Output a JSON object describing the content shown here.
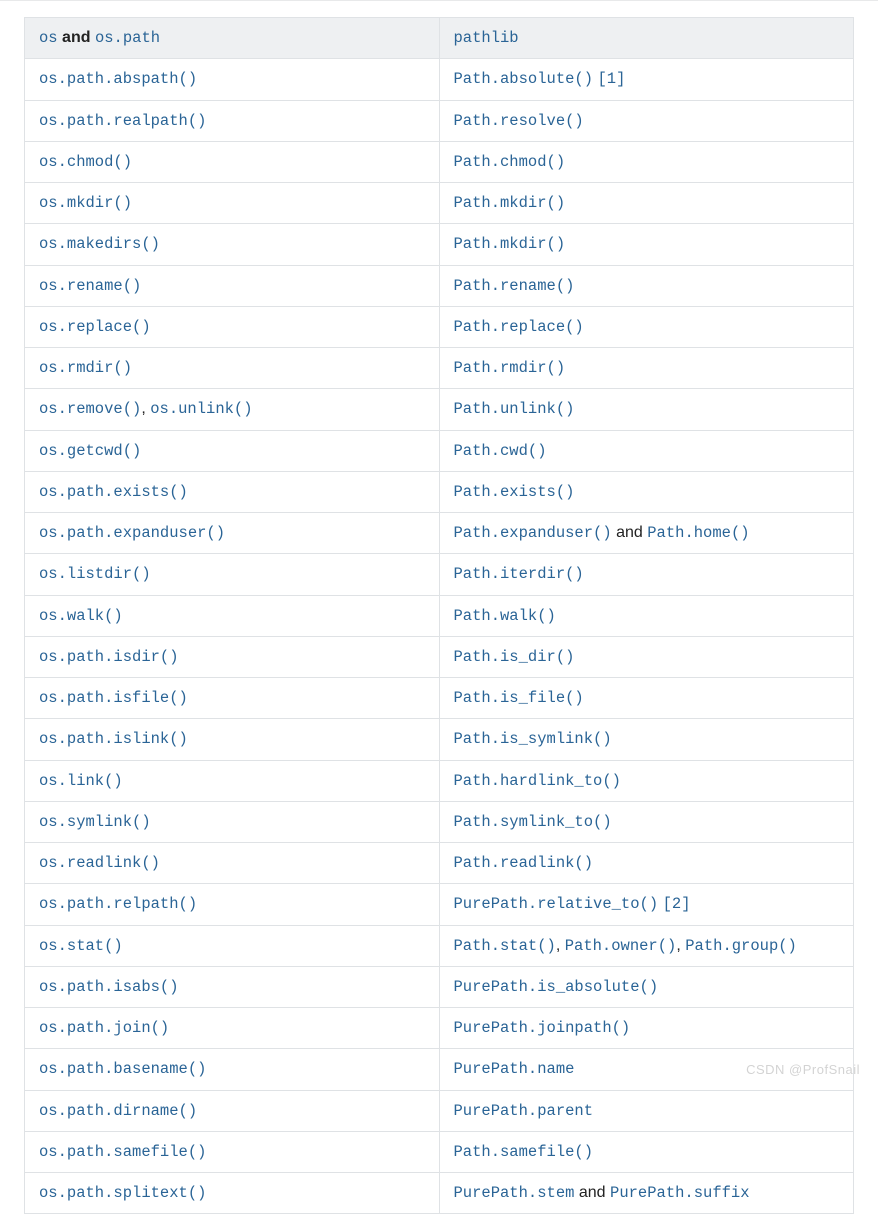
{
  "header": {
    "left": {
      "parts": [
        {
          "type": "link",
          "text": "os"
        },
        {
          "type": "bold",
          "text": " and "
        },
        {
          "type": "link",
          "text": "os.path"
        }
      ]
    },
    "right": {
      "parts": [
        {
          "type": "link",
          "text": "pathlib"
        }
      ]
    }
  },
  "rows": [
    {
      "left": [
        {
          "type": "link",
          "text": "os.path.abspath()"
        }
      ],
      "right": [
        {
          "type": "link",
          "text": "Path.absolute()"
        },
        {
          "type": "plain",
          "text": " "
        },
        {
          "type": "link",
          "text": "[1]"
        }
      ]
    },
    {
      "left": [
        {
          "type": "link",
          "text": "os.path.realpath()"
        }
      ],
      "right": [
        {
          "type": "link",
          "text": "Path.resolve()"
        }
      ]
    },
    {
      "left": [
        {
          "type": "link",
          "text": "os.chmod()"
        }
      ],
      "right": [
        {
          "type": "link",
          "text": "Path.chmod()"
        }
      ]
    },
    {
      "left": [
        {
          "type": "link",
          "text": "os.mkdir()"
        }
      ],
      "right": [
        {
          "type": "link",
          "text": "Path.mkdir()"
        }
      ]
    },
    {
      "left": [
        {
          "type": "link",
          "text": "os.makedirs()"
        }
      ],
      "right": [
        {
          "type": "link",
          "text": "Path.mkdir()"
        }
      ]
    },
    {
      "left": [
        {
          "type": "link",
          "text": "os.rename()"
        }
      ],
      "right": [
        {
          "type": "link",
          "text": "Path.rename()"
        }
      ]
    },
    {
      "left": [
        {
          "type": "link",
          "text": "os.replace()"
        }
      ],
      "right": [
        {
          "type": "link",
          "text": "Path.replace()"
        }
      ]
    },
    {
      "left": [
        {
          "type": "link",
          "text": "os.rmdir()"
        }
      ],
      "right": [
        {
          "type": "link",
          "text": "Path.rmdir()"
        }
      ]
    },
    {
      "left": [
        {
          "type": "link",
          "text": "os.remove()"
        },
        {
          "type": "sep",
          "text": ", "
        },
        {
          "type": "link",
          "text": "os.unlink()"
        }
      ],
      "right": [
        {
          "type": "link",
          "text": "Path.unlink()"
        }
      ]
    },
    {
      "left": [
        {
          "type": "link",
          "text": "os.getcwd()"
        }
      ],
      "right": [
        {
          "type": "link",
          "text": "Path.cwd()"
        }
      ]
    },
    {
      "left": [
        {
          "type": "link",
          "text": "os.path.exists()"
        }
      ],
      "right": [
        {
          "type": "link",
          "text": "Path.exists()"
        }
      ]
    },
    {
      "left": [
        {
          "type": "link",
          "text": "os.path.expanduser()"
        }
      ],
      "right": [
        {
          "type": "link",
          "text": "Path.expanduser()"
        },
        {
          "type": "plain",
          "text": " and "
        },
        {
          "type": "link",
          "text": "Path.home()"
        }
      ]
    },
    {
      "left": [
        {
          "type": "link",
          "text": "os.listdir()"
        }
      ],
      "right": [
        {
          "type": "link",
          "text": "Path.iterdir()"
        }
      ]
    },
    {
      "left": [
        {
          "type": "link",
          "text": "os.walk()"
        }
      ],
      "right": [
        {
          "type": "link",
          "text": "Path.walk()"
        }
      ]
    },
    {
      "left": [
        {
          "type": "link",
          "text": "os.path.isdir()"
        }
      ],
      "right": [
        {
          "type": "link",
          "text": "Path.is_dir()"
        }
      ]
    },
    {
      "left": [
        {
          "type": "link",
          "text": "os.path.isfile()"
        }
      ],
      "right": [
        {
          "type": "link",
          "text": "Path.is_file()"
        }
      ]
    },
    {
      "left": [
        {
          "type": "link",
          "text": "os.path.islink()"
        }
      ],
      "right": [
        {
          "type": "link",
          "text": "Path.is_symlink()"
        }
      ]
    },
    {
      "left": [
        {
          "type": "link",
          "text": "os.link()"
        }
      ],
      "right": [
        {
          "type": "link",
          "text": "Path.hardlink_to()"
        }
      ]
    },
    {
      "left": [
        {
          "type": "link",
          "text": "os.symlink()"
        }
      ],
      "right": [
        {
          "type": "link",
          "text": "Path.symlink_to()"
        }
      ]
    },
    {
      "left": [
        {
          "type": "link",
          "text": "os.readlink()"
        }
      ],
      "right": [
        {
          "type": "link",
          "text": "Path.readlink()"
        }
      ]
    },
    {
      "left": [
        {
          "type": "link",
          "text": "os.path.relpath()"
        }
      ],
      "right": [
        {
          "type": "link",
          "text": "PurePath.relative_to()"
        },
        {
          "type": "plain",
          "text": " "
        },
        {
          "type": "link",
          "text": "[2]"
        }
      ]
    },
    {
      "left": [
        {
          "type": "link",
          "text": "os.stat()"
        }
      ],
      "right": [
        {
          "type": "link",
          "text": "Path.stat()"
        },
        {
          "type": "sep",
          "text": ", "
        },
        {
          "type": "link",
          "text": "Path.owner()"
        },
        {
          "type": "sep",
          "text": ", "
        },
        {
          "type": "link",
          "text": "Path.group()"
        }
      ]
    },
    {
      "left": [
        {
          "type": "link",
          "text": "os.path.isabs()"
        }
      ],
      "right": [
        {
          "type": "link",
          "text": "PurePath.is_absolute()"
        }
      ]
    },
    {
      "left": [
        {
          "type": "link",
          "text": "os.path.join()"
        }
      ],
      "right": [
        {
          "type": "link",
          "text": "PurePath.joinpath()"
        }
      ]
    },
    {
      "left": [
        {
          "type": "link",
          "text": "os.path.basename()"
        }
      ],
      "right": [
        {
          "type": "link",
          "text": "PurePath.name"
        }
      ]
    },
    {
      "left": [
        {
          "type": "link",
          "text": "os.path.dirname()"
        }
      ],
      "right": [
        {
          "type": "link",
          "text": "PurePath.parent"
        }
      ]
    },
    {
      "left": [
        {
          "type": "link",
          "text": "os.path.samefile()"
        }
      ],
      "right": [
        {
          "type": "link",
          "text": "Path.samefile()"
        }
      ]
    },
    {
      "left": [
        {
          "type": "link",
          "text": "os.path.splitext()"
        }
      ],
      "right": [
        {
          "type": "link",
          "text": "PurePath.stem"
        },
        {
          "type": "plain",
          "text": " and "
        },
        {
          "type": "link",
          "text": "PurePath.suffix"
        }
      ]
    }
  ],
  "watermark": "CSDN @ProfSnail"
}
